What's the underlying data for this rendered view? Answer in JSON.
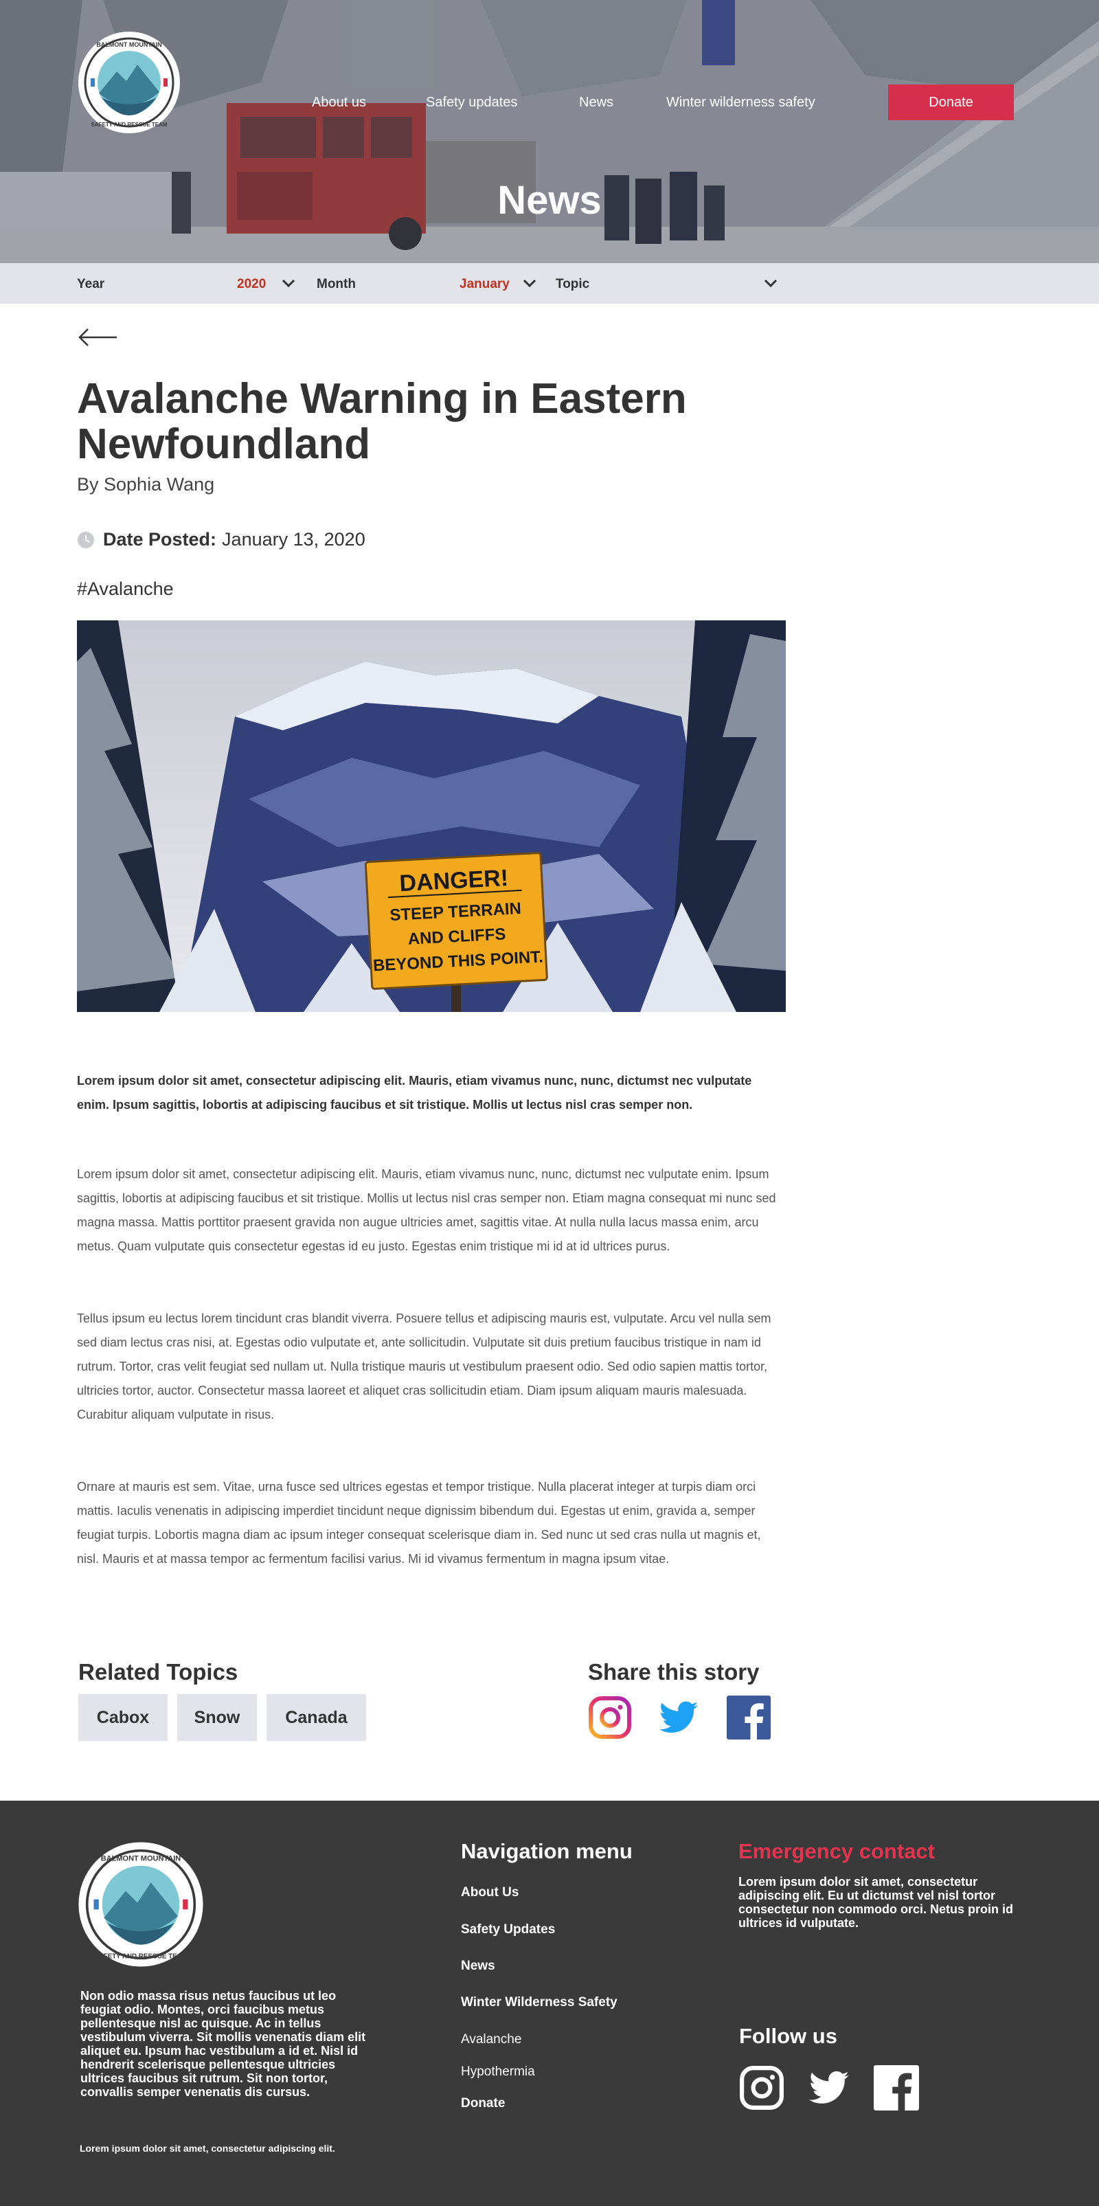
{
  "colors": {
    "accent_red": "#d62f4b",
    "filter_value": "#c0311f",
    "filter_bar": "#e2e4ea",
    "footer_bg": "#3a3a3a",
    "emergency_title": "#e3334e"
  },
  "header": {
    "logo_text": "BALMONT MOUNTAIN SAFETY AND RESCUE TEAM",
    "nav": [
      "About us",
      "Safety updates",
      "News",
      "Winter wilderness safety"
    ],
    "donate_label": "Donate",
    "title": "News"
  },
  "filters": {
    "year_label": "Year",
    "year_value": "2020",
    "month_label": "Month",
    "month_value": "January",
    "topic_label": "Topic"
  },
  "article": {
    "back_icon": "arrow-left-icon",
    "title": "Avalanche Warning in Eastern Newfoundland",
    "byline": "By Sophia Wang",
    "date_label": "Date Posted:",
    "date_value": "January 13, 2020",
    "hashtag": "#Avalanche",
    "image_sign": [
      "DANGER!",
      "STEEP TERRAIN",
      "AND CLIFFS",
      "BEYOND THIS POINT."
    ],
    "lead": "Lorem ipsum dolor sit amet, consectetur adipiscing elit. Mauris, etiam vivamus nunc, nunc, dictumst nec vulputate enim. Ipsum sagittis, lobortis at adipiscing faucibus et sit tristique. Mollis ut lectus nisl cras semper non.",
    "paragraphs": [
      "Lorem ipsum dolor sit amet, consectetur adipiscing elit. Mauris, etiam vivamus nunc, nunc, dictumst nec vulputate enim. Ipsum sagittis, lobortis at adipiscing faucibus et sit tristique. Mollis ut lectus nisl cras semper non. Etiam magna consequat mi nunc sed magna massa. Mattis porttitor praesent gravida non augue ultricies amet, sagittis vitae. At nulla nulla lacus massa enim, arcu metus. Quam vulputate quis consectetur egestas id eu justo. Egestas enim tristique mi id at id ultrices purus.",
      "Tellus ipsum eu lectus lorem tincidunt cras blandit viverra. Posuere tellus et adipiscing mauris est, vulputate. Arcu vel nulla sem sed diam lectus cras nisi, at. Egestas odio vulputate et, ante sollicitudin. Vulputate sit duis pretium faucibus tristique in nam id rutrum. Tortor, cras velit feugiat sed nullam ut. Nulla tristique mauris ut vestibulum praesent odio. Sed odio sapien mattis tortor, ultricies tortor, auctor. Consectetur massa laoreet et aliquet cras sollicitudin etiam. Diam ipsum aliquam mauris malesuada. Curabitur aliquam vulputate in risus.",
      "Ornare at mauris est sem. Vitae, urna fusce sed ultrices egestas et tempor tristique. Nulla placerat integer at turpis diam orci mattis. Iaculis venenatis in adipiscing imperdiet tincidunt neque dignissim bibendum dui. Egestas ut enim, gravida a, semper feugiat turpis. Lobortis magna diam ac ipsum integer consequat scelerisque diam in. Sed nunc ut sed cras nulla ut magnis et, nisl. Mauris et at massa tempor ac fermentum facilisi varius. Mi id vivamus fermentum in magna ipsum vitae."
    ]
  },
  "related": {
    "title": "Related Topics",
    "tags": [
      "Cabox",
      "Snow",
      "Canada"
    ]
  },
  "share": {
    "title": "Share this story",
    "icons": [
      "instagram-icon",
      "twitter-icon",
      "facebook-icon"
    ]
  },
  "footer": {
    "about": "Non odio massa risus netus faucibus ut leo feugiat odio. Montes, orci faucibus metus pellentesque nisl ac quisque. Ac in tellus vestibulum viverra. Sit mollis venenatis diam elit aliquet eu. Ipsum hac vestibulum a id et. Nisl id hendrerit scelerisque pellentesque ultricies ultrices faucibus sit rutrum. Sit non tortor, convallis semper venenatis dis cursus.",
    "bottom_text": "Lorem ipsum dolor sit amet, consectetur adipiscing elit.",
    "nav_title": "Navigation menu",
    "nav_links": [
      "About Us",
      "Safety Updates",
      "News",
      "Winter Wilderness Safety",
      "Avalanche",
      "Hypothermia",
      "Donate"
    ],
    "emergency_title": "Emergency contact",
    "emergency_text": "Lorem ipsum dolor sit amet, consectetur adipiscing elit. Eu ut dictumst vel nisl tortor consectetur non commodo orci. Netus proin id ultrices id vulputate.",
    "follow_title": "Follow us"
  }
}
